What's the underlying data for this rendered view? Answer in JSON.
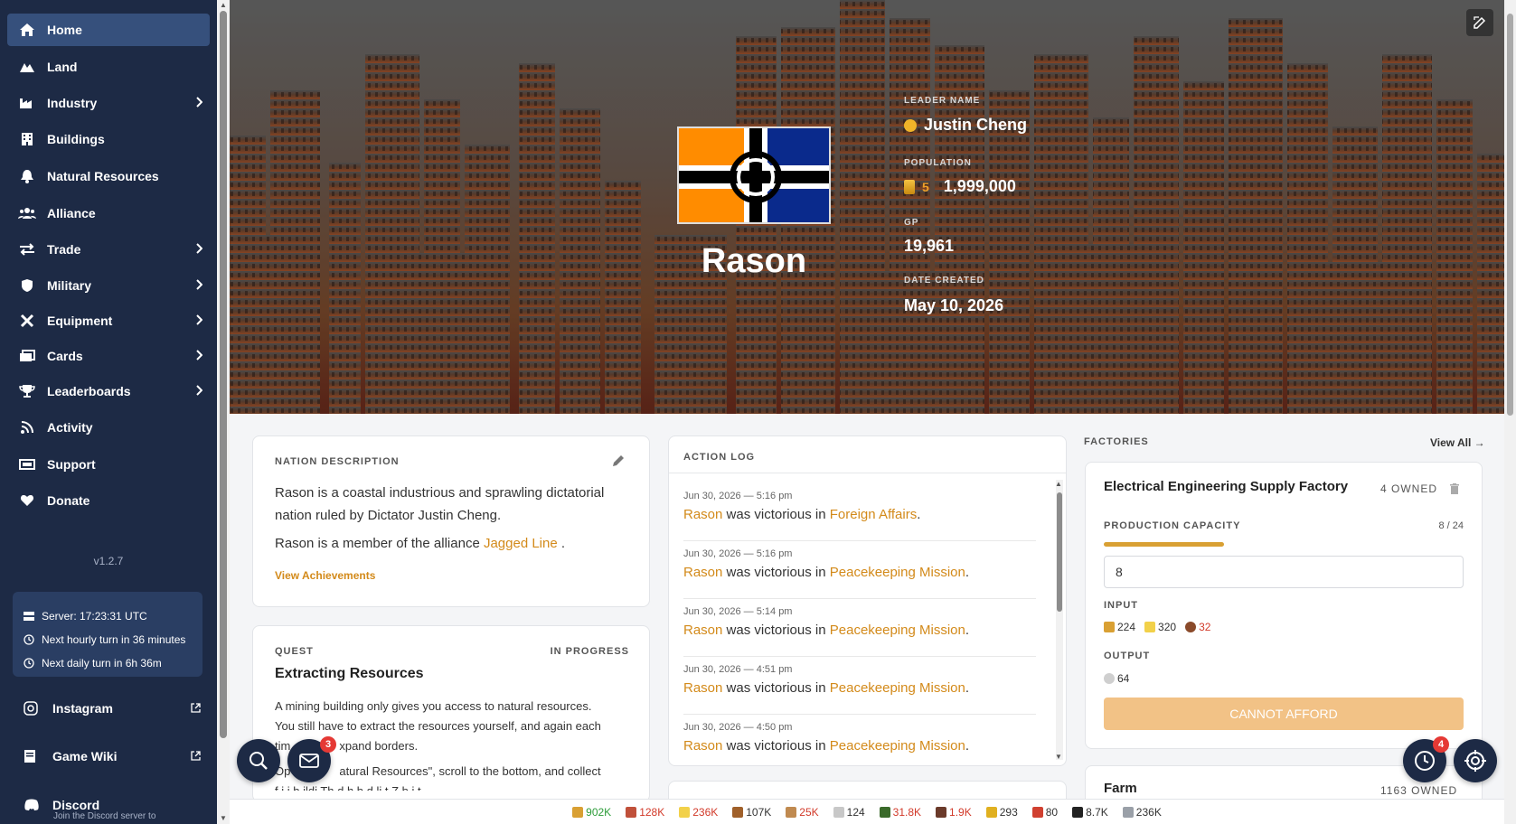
{
  "sidebar": {
    "items": [
      {
        "label": "Home",
        "icon": "home-icon",
        "active": true
      },
      {
        "label": "Land",
        "icon": "land-icon"
      },
      {
        "label": "Industry",
        "icon": "industry-icon",
        "chevron": true
      },
      {
        "label": "Buildings",
        "icon": "buildings-icon"
      },
      {
        "label": "Natural Resources",
        "icon": "natural-resources-icon"
      },
      {
        "label": "Alliance",
        "icon": "alliance-icon"
      },
      {
        "label": "Trade",
        "icon": "trade-icon",
        "chevron": true
      },
      {
        "label": "Military",
        "icon": "shield-icon",
        "chevron": true
      },
      {
        "label": "Equipment",
        "icon": "tools-icon",
        "chevron": true
      },
      {
        "label": "Cards",
        "icon": "cards-icon",
        "chevron": true
      },
      {
        "label": "Leaderboards",
        "icon": "trophy-icon",
        "chevron": true
      },
      {
        "label": "Activity",
        "icon": "rss-icon"
      },
      {
        "label": "Support",
        "icon": "support-icon"
      },
      {
        "label": "Donate",
        "icon": "heart-icon"
      }
    ],
    "version": "v1.2.7",
    "server": {
      "time": "Server: 17:23:31 UTC",
      "hourly": "Next hourly turn in 36 minutes",
      "daily": "Next daily turn in 6h 36m"
    },
    "links": {
      "instagram": "Instagram",
      "wiki": "Game Wiki",
      "discord": "Discord",
      "discord_sub": "Join the Discord server to"
    }
  },
  "hero": {
    "nation_name": "Rason",
    "leader_label": "LEADER NAME",
    "leader_name": "Justin Cheng",
    "population_label": "POPULATION",
    "population_rank": "5",
    "population": "1,999,000",
    "gp_label": "GP",
    "gp": "19,961",
    "date_label": "DATE CREATED",
    "date": "May 10, 2026",
    "flag_colors": {
      "left": "#ff8c00",
      "right": "#0a2a8c",
      "cross": "#000000"
    }
  },
  "description": {
    "title": "NATION DESCRIPTION",
    "text1": "Rason is a coastal industrious and sprawling dictatorial nation ruled by Dictator Justin Cheng.",
    "text2_prefix": "Rason is a member of the alliance",
    "alliance": "Jagged Line",
    "text2_suffix": ".",
    "achievements": "View Achievements"
  },
  "quest": {
    "label": "QUEST",
    "status": "IN PROGRESS",
    "title": "Extracting Resources",
    "line1": "A mining building only gives you access to natural resources.",
    "line2": "You still have to extract the resources yourself, and again each",
    "line3a": "tim",
    "line3b": "xpand borders.",
    "line4a": "Op",
    "line4b": "atural Resources\", scroll to the bottom, and collect",
    "line5": "f                      i  i   b ildi   Th           d  h  b d li t  Z  b   i t"
  },
  "action_log": {
    "title": "ACTION LOG",
    "entries": [
      {
        "date": "Jun 30, 2026 — 5:16 pm",
        "actor": "Rason",
        "verb": "was victorious in",
        "event": "Foreign Affairs"
      },
      {
        "date": "Jun 30, 2026 — 5:16 pm",
        "actor": "Rason",
        "verb": "was victorious in",
        "event": "Peacekeeping Mission"
      },
      {
        "date": "Jun 30, 2026 — 5:14 pm",
        "actor": "Rason",
        "verb": "was victorious in",
        "event": "Peacekeeping Mission"
      },
      {
        "date": "Jun 30, 2026 — 4:51 pm",
        "actor": "Rason",
        "verb": "was victorious in",
        "event": "Peacekeeping Mission"
      },
      {
        "date": "Jun 30, 2026 — 4:50 pm",
        "actor": "Rason",
        "verb": "was victorious in",
        "event": "Peacekeeping Mission"
      }
    ]
  },
  "factories": {
    "title": "FACTORIES",
    "view_all": "View All →",
    "factory": {
      "name": "Electrical Engineering Supply Factory",
      "owned": "4 OWNED",
      "capacity_label": "PRODUCTION CAPACITY",
      "capacity": "8 / 24",
      "capacity_fraction": 0.333,
      "input_value": "8",
      "input_label": "INPUT",
      "inputs": [
        {
          "icon": "gold-icon",
          "value": "224"
        },
        {
          "icon": "lightning-icon",
          "value": "320"
        },
        {
          "icon": "ore-icon",
          "value": "32",
          "color": "#d23a2a"
        }
      ],
      "output_label": "OUTPUT",
      "outputs": [
        {
          "icon": "component-icon",
          "value": "64"
        }
      ],
      "button": "CANNOT AFFORD"
    },
    "next_factory": {
      "name": "Farm",
      "owned": "1163 OWNED"
    }
  },
  "fabs": {
    "mail_badge": "3",
    "clock_badge": "4"
  },
  "resources": [
    {
      "icon": "gold-icon",
      "value": "902K",
      "color": "#2e9d3a"
    },
    {
      "icon": "meat-icon",
      "value": "128K",
      "color": "#d23a2a"
    },
    {
      "icon": "lightning-icon",
      "value": "236K",
      "color": "#d23a2a"
    },
    {
      "icon": "wood-icon",
      "value": "107K",
      "color": "#333333"
    },
    {
      "icon": "bread-icon",
      "value": "25K",
      "color": "#d23a2a"
    },
    {
      "icon": "stone-icon",
      "value": "124",
      "color": "#333333"
    },
    {
      "icon": "leaf-icon",
      "value": "31.8K",
      "color": "#d23a2a"
    },
    {
      "icon": "barrel-icon",
      "value": "1.9K",
      "color": "#d23a2a"
    },
    {
      "icon": "radiation-icon",
      "value": "293",
      "color": "#333333"
    },
    {
      "icon": "rocket-icon",
      "value": "80",
      "color": "#333333"
    },
    {
      "icon": "wrench-icon",
      "value": "8.7K",
      "color": "#333333"
    },
    {
      "icon": "money-icon",
      "value": "236K",
      "color": "#333333"
    }
  ]
}
